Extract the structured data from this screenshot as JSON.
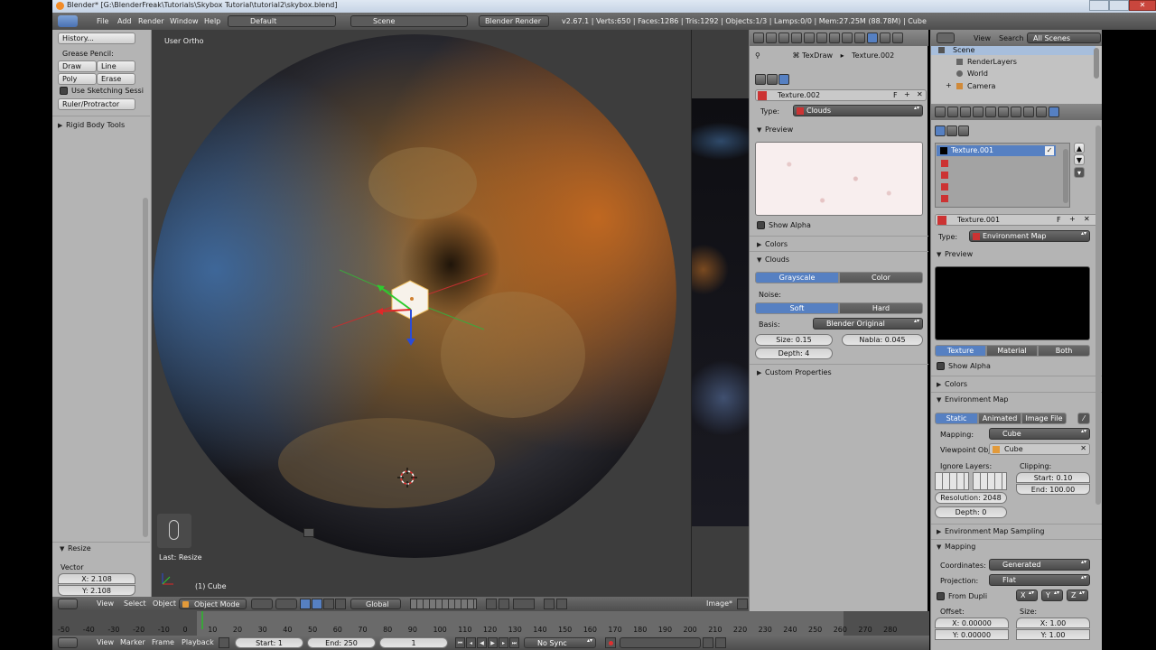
{
  "titlebar": {
    "title": "Blender* [G:\\BlenderFreak\\Tutorials\\Skybox Tutorial\\tutorial2\\skybox.blend]"
  },
  "menubar": {
    "menus": [
      "File",
      "Add",
      "Render",
      "Window",
      "Help"
    ],
    "layout": "Default",
    "scene": "Scene",
    "engine": "Blender Render",
    "stats": "v2.67.1 | Verts:650 | Faces:1286 | Tris:1292 | Objects:1/3 | Lamps:0/0 | Mem:27.25M (88.78M) | Cube"
  },
  "toolshelf": {
    "history": "History...",
    "grease_pencil": "Grease Pencil:",
    "draw": "Draw",
    "line": "Line",
    "poly": "Poly",
    "erase": "Erase",
    "sketching": "Use Sketching Sessi",
    "ruler": "Ruler/Protractor",
    "rigid": "Rigid Body Tools",
    "resize_title": "Resize",
    "vector_label": "Vector",
    "vector_x": "X: 2.108",
    "vector_y": "Y: 2.108"
  },
  "viewport": {
    "view_label": "User Ortho",
    "last_op": "Last: Resize",
    "object_label": "(1) Cube",
    "header": {
      "view": "View",
      "select": "Select",
      "object": "Object",
      "mode": "Object Mode",
      "orientation": "Global"
    }
  },
  "image_editor": {
    "label": "Image*"
  },
  "texture_panel": {
    "breadcrumb_node": "TexDraw",
    "breadcrumb_tex": "Texture.002",
    "texture_name": "Texture.002",
    "fake_user": "F",
    "type_label": "Type:",
    "type_value": "Clouds",
    "preview": "Preview",
    "show_alpha": "Show Alpha",
    "colors": "Colors",
    "clouds": "Clouds",
    "grayscale": "Grayscale",
    "color": "Color",
    "noise_label": "Noise:",
    "soft": "Soft",
    "hard": "Hard",
    "basis_label": "Basis:",
    "basis_value": "Blender Original",
    "size": "Size: 0.15",
    "nabla": "Nabla: 0.045",
    "depth": "Depth: 4",
    "custom_props": "Custom Properties"
  },
  "outliner": {
    "view": "View",
    "search": "Search",
    "all_scenes": "All Scenes",
    "items": [
      "Scene",
      "RenderLayers",
      "World",
      "Camera"
    ]
  },
  "env_panel": {
    "slot_selected": "Texture.001",
    "texture_name": "Texture.001",
    "fake_user": "F",
    "type_label": "Type:",
    "type_value": "Environment Map",
    "preview": "Preview",
    "tab_texture": "Texture",
    "tab_material": "Material",
    "tab_both": "Both",
    "show_alpha": "Show Alpha",
    "colors": "Colors",
    "envmap": "Environment Map",
    "static": "Static",
    "animated": "Animated",
    "image_file": "Image File",
    "mapping_label": "Mapping:",
    "mapping_value": "Cube",
    "viewpoint_label": "Viewpoint Obj",
    "viewpoint_value": "Cube",
    "ignore_layers": "Ignore Layers:",
    "clipping": "Clipping:",
    "clip_start": "Start: 0.10",
    "clip_end": "End: 100.00",
    "resolution": "Resolution: 2048",
    "depth": "Depth: 0",
    "sampling": "Environment Map Sampling",
    "mapping_section": "Mapping",
    "coordinates_label": "Coordinates:",
    "coordinates_value": "Generated",
    "projection_label": "Projection:",
    "projection_value": "Flat",
    "from_dupli": "From Dupli",
    "x": "X",
    "y": "Y",
    "z": "Z",
    "offset_label": "Offset:",
    "size_label": "Size:",
    "offset_x": "X: 0.00000",
    "offset_y": "Y: 0.00000",
    "size_x": "X: 1.00",
    "size_y": "Y: 1.00"
  },
  "timeline": {
    "ruler": [
      "-50",
      "-40",
      "-30",
      "-20",
      "-10",
      "0",
      "10",
      "20",
      "30",
      "40",
      "50",
      "60",
      "70",
      "80",
      "90",
      "100",
      "110",
      "120",
      "130",
      "140",
      "150",
      "160",
      "170",
      "180",
      "190",
      "200",
      "210",
      "220",
      "230",
      "240",
      "250",
      "260",
      "270",
      "280"
    ],
    "view": "View",
    "marker": "Marker",
    "frame": "Frame",
    "playback": "Playback",
    "start": "Start: 1",
    "end": "End: 250",
    "current": "1",
    "sync": "No Sync"
  },
  "colors": {
    "accent": "#5680c2",
    "panel": "#b4b4b4",
    "viewport": "#3d3d3d"
  }
}
